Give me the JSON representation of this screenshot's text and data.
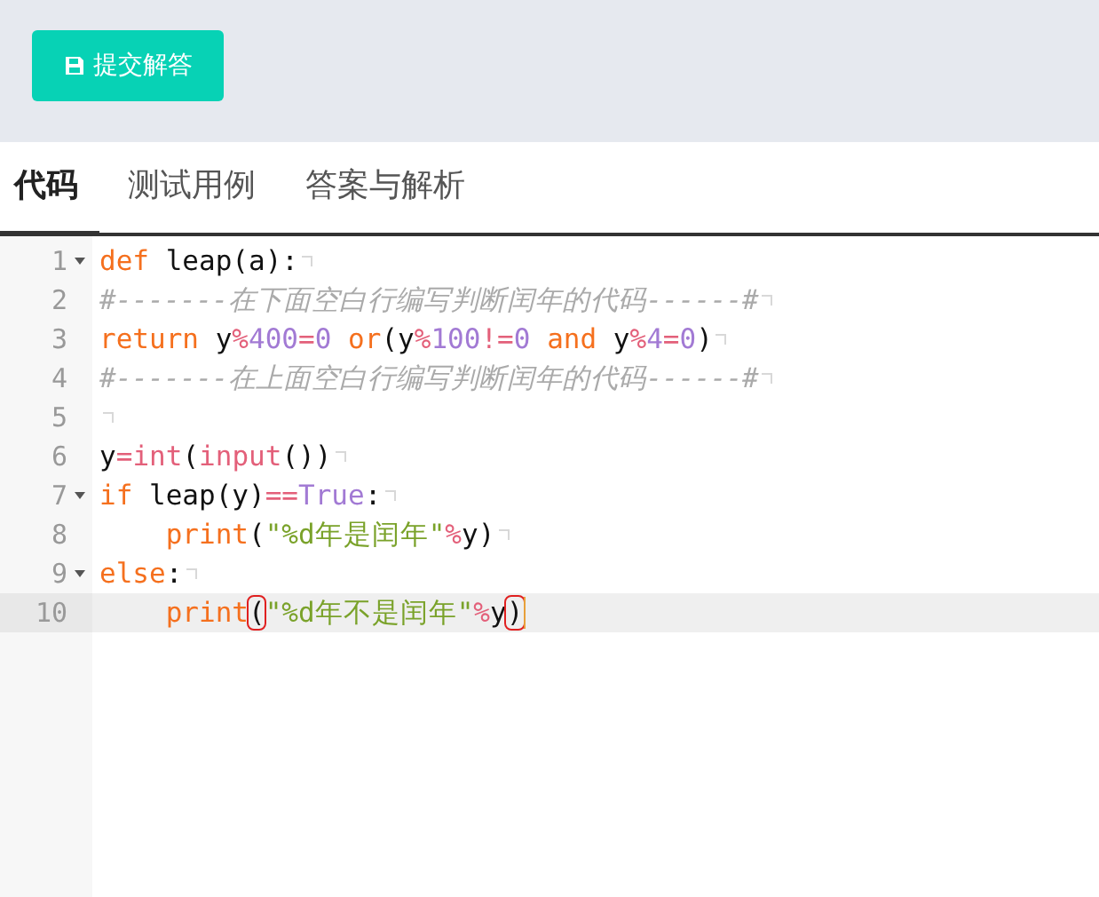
{
  "toolbar": {
    "submit_button": "提交解答"
  },
  "tabs": [
    {
      "label": "代码",
      "selected": true
    },
    {
      "label": "测试用例",
      "selected": false
    },
    {
      "label": "答案与解析",
      "selected": false
    }
  ],
  "editor": {
    "lines": [
      {
        "number": "1",
        "foldable": true,
        "active": false,
        "eol_mark": true,
        "tokens": [
          {
            "kind": "keyword",
            "text": "def"
          },
          {
            "kind": "plain",
            "text": " leap(a):"
          }
        ]
      },
      {
        "number": "2",
        "foldable": false,
        "active": false,
        "eol_mark": true,
        "tokens": [
          {
            "kind": "comment",
            "text": "#-------在下面空白行编写判断闰年的代码------#"
          }
        ]
      },
      {
        "number": "3",
        "foldable": false,
        "active": false,
        "eol_mark": true,
        "tokens": [
          {
            "kind": "keyword",
            "text": "return"
          },
          {
            "kind": "plain",
            "text": " y"
          },
          {
            "kind": "operator",
            "text": "%"
          },
          {
            "kind": "number",
            "text": "400"
          },
          {
            "kind": "operator",
            "text": "="
          },
          {
            "kind": "number",
            "text": "0"
          },
          {
            "kind": "keyword",
            "text": " or"
          },
          {
            "kind": "plain",
            "text": "(y"
          },
          {
            "kind": "operator",
            "text": "%"
          },
          {
            "kind": "number",
            "text": "100"
          },
          {
            "kind": "operator",
            "text": "!="
          },
          {
            "kind": "number",
            "text": "0"
          },
          {
            "kind": "keyword",
            "text": " and"
          },
          {
            "kind": "plain",
            "text": " y"
          },
          {
            "kind": "operator",
            "text": "%"
          },
          {
            "kind": "number",
            "text": "4"
          },
          {
            "kind": "operator",
            "text": "="
          },
          {
            "kind": "number",
            "text": "0"
          },
          {
            "kind": "plain",
            "text": ")"
          }
        ]
      },
      {
        "number": "4",
        "foldable": false,
        "active": false,
        "eol_mark": true,
        "tokens": [
          {
            "kind": "comment",
            "text": "#-------在上面空白行编写判断闰年的代码------#"
          }
        ]
      },
      {
        "number": "5",
        "foldable": false,
        "active": false,
        "eol_mark": true
      },
      {
        "number": "6",
        "foldable": false,
        "active": false,
        "eol_mark": true,
        "tokens": [
          {
            "kind": "plain",
            "text": "y"
          },
          {
            "kind": "operator",
            "text": "="
          },
          {
            "kind": "builtin",
            "text": "int"
          },
          {
            "kind": "plain",
            "text": "("
          },
          {
            "kind": "builtin",
            "text": "input"
          },
          {
            "kind": "plain",
            "text": "())"
          }
        ]
      },
      {
        "number": "7",
        "foldable": true,
        "active": false,
        "eol_mark": true,
        "tokens": [
          {
            "kind": "keyword",
            "text": "if"
          },
          {
            "kind": "plain",
            "text": " leap(y)"
          },
          {
            "kind": "operator",
            "text": "=="
          },
          {
            "kind": "constant",
            "text": "True"
          },
          {
            "kind": "plain",
            "text": ":"
          }
        ]
      },
      {
        "number": "8",
        "foldable": false,
        "active": false,
        "eol_mark": true,
        "tokens": [
          {
            "kind": "keyword",
            "text": "    print"
          },
          {
            "kind": "plain",
            "text": "("
          },
          {
            "kind": "string",
            "text": "\"%d年是闰年\""
          },
          {
            "kind": "operator",
            "text": "%"
          },
          {
            "kind": "plain",
            "text": "y)"
          }
        ]
      },
      {
        "number": "9",
        "foldable": true,
        "active": false,
        "eol_mark": true,
        "tokens": [
          {
            "kind": "keyword",
            "text": "else"
          },
          {
            "kind": "plain",
            "text": ":"
          }
        ]
      },
      {
        "number": "10",
        "foldable": false,
        "active": true,
        "eol_mark": false,
        "tokens": [
          {
            "kind": "keyword",
            "text": "    print"
          },
          {
            "kind": "plain",
            "text": "(",
            "matched": true
          },
          {
            "kind": "string",
            "text": "\"%d年不是闰年\""
          },
          {
            "kind": "operator",
            "text": "%"
          },
          {
            "kind": "plain",
            "text": "y"
          },
          {
            "kind": "plain",
            "text": ")",
            "matched": true
          }
        ]
      }
    ]
  }
}
